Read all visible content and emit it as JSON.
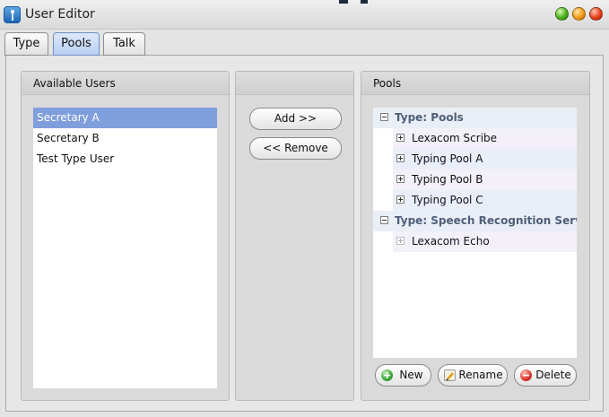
{
  "window": {
    "title": "User Editor"
  },
  "tabs": [
    {
      "label": "Type",
      "active": false
    },
    {
      "label": "Pools",
      "active": true
    },
    {
      "label": "Talk",
      "active": false
    }
  ],
  "available_users": {
    "header": "Available Users",
    "items": [
      {
        "label": "Secretary A",
        "selected": true
      },
      {
        "label": "Secretary B",
        "selected": false
      },
      {
        "label": "Test Type User",
        "selected": false
      }
    ]
  },
  "actions": {
    "add_label": "Add >>",
    "remove_label": "<< Remove"
  },
  "pools": {
    "header": "Pools",
    "groups": [
      {
        "label": "Type: Pools",
        "expanded": true,
        "children": [
          "Lexacom Scribe",
          "Typing Pool A",
          "Typing Pool B",
          "Typing Pool C"
        ]
      },
      {
        "label": "Type: Speech Recognition Servi",
        "expanded": true,
        "children": [
          "Lexacom Echo"
        ]
      }
    ],
    "buttons": {
      "new_label": "New",
      "rename_label": "Rename",
      "delete_label": "Delete"
    }
  },
  "colors": {
    "selection": "#7f9edc",
    "active_tab": "#b7cff2",
    "group_text": "#4e5f7a",
    "new_icon": "#3aa53a",
    "delete_icon": "#d9342b"
  },
  "icons": {
    "app": "app-icon",
    "minimize": "minimize-icon",
    "maximize": "maximize-icon",
    "close": "close-icon",
    "collapse": "minus-box-icon",
    "expand": "plus-box-icon",
    "new": "plus-circle-icon",
    "rename": "pencil-icon",
    "delete": "minus-circle-icon"
  }
}
